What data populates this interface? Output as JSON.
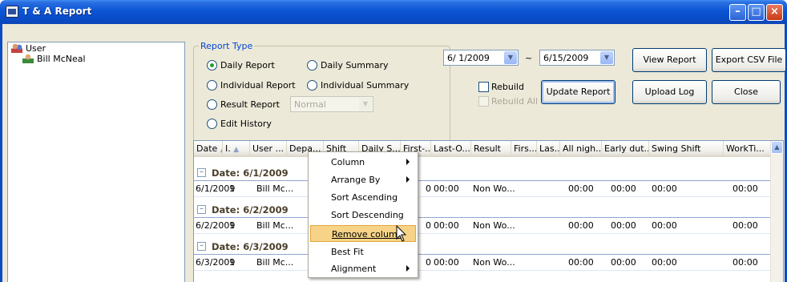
{
  "window": {
    "title": "T & A Report"
  },
  "tree": {
    "root": "User",
    "child": "Bill McNeal"
  },
  "report_type": {
    "label": "Report Type",
    "options": [
      {
        "label": "Daily Report",
        "checked": true
      },
      {
        "label": "Daily Summary",
        "checked": false
      },
      {
        "label": "Individual Report",
        "checked": false
      },
      {
        "label": "Individual Summary",
        "checked": false
      },
      {
        "label": "Result Report",
        "checked": false
      },
      {
        "label": "Edit History",
        "checked": false
      }
    ],
    "result_combo": "Normal"
  },
  "dates": {
    "from": "6/ 1/2009",
    "separator": "~",
    "to": "6/15/2009"
  },
  "checks": {
    "rebuild": "Rebuild",
    "rebuild_all": "Rebuild All"
  },
  "buttons": {
    "view_report": "View Report",
    "export_csv": "Export CSV File",
    "update_report": "Update Report",
    "upload_log": "Upload Log",
    "close": "Close"
  },
  "grid": {
    "columns": [
      "Date",
      "I.",
      "User ...",
      "Depa...",
      "Shift",
      "Daily S...",
      "First-...",
      "Last-O...",
      "Result",
      "Firs...",
      "Las...",
      "All nigh...",
      "Early dut...",
      "Swing Shift",
      "WorkTi..."
    ],
    "groups": [
      {
        "header": "Date: 6/1/2009",
        "row": {
          "date": "6/1/2009",
          "id": "1",
          "user": "Bill Mc...",
          "first": "0",
          "last": "00:00",
          "result": "Non Wo...",
          "allnight": "00:00",
          "early": "00:00",
          "swing": "00:00",
          "work": "00:00"
        }
      },
      {
        "header": "Date: 6/2/2009",
        "row": {
          "date": "6/2/2009",
          "id": "1",
          "user": "Bill Mc...",
          "first": "0",
          "last": "00:00",
          "result": "Non Wo...",
          "allnight": "00:00",
          "early": "00:00",
          "swing": "00:00",
          "work": "00:00"
        }
      },
      {
        "header": "Date: 6/3/2009",
        "row": {
          "date": "6/3/2009",
          "id": "1",
          "user": "Bill Mc...",
          "first": "0",
          "last": "00:00",
          "result": "Non Wo...",
          "allnight": "00:00",
          "early": "00:00",
          "swing": "00:00",
          "work": "00:00"
        }
      }
    ]
  },
  "context_menu": {
    "items": [
      "Column",
      "Arrange By",
      "Sort Ascending",
      "Sort Descending",
      "Remove column",
      "Best Fit",
      "Alignment"
    ],
    "highlighted": "Remove column"
  },
  "icons": {
    "app": "report-window-icon",
    "tree_root": "users-group-icon",
    "tree_child": "user-icon",
    "cursor": "arrow-cursor-icon"
  }
}
